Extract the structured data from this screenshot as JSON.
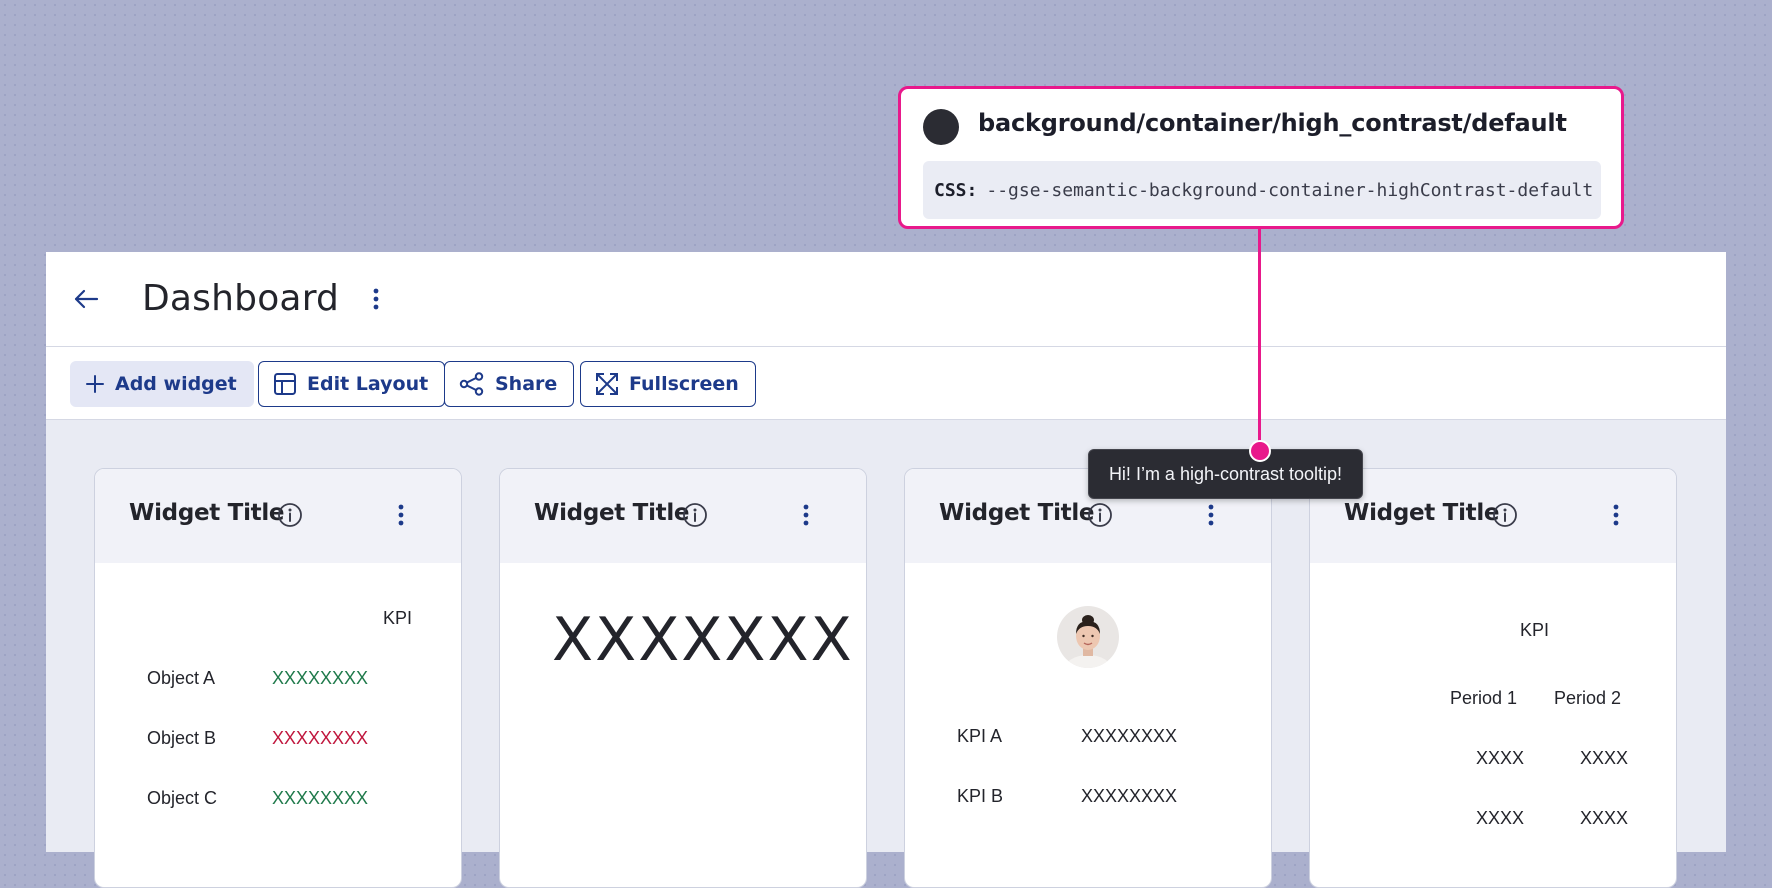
{
  "header": {
    "title": "Dashboard"
  },
  "toolbar": {
    "add_widget": "Add widget",
    "edit_layout": "Edit Layout",
    "share": "Share",
    "fullscreen": "Fullscreen"
  },
  "widgets": [
    {
      "title": "Widget Title",
      "kpi_header": "KPI",
      "rows": [
        {
          "label": "Object A",
          "value": "XXXXXXXX",
          "status": "positive"
        },
        {
          "label": "Object B",
          "value": "XXXXXXXX",
          "status": "negative"
        },
        {
          "label": "Object C",
          "value": "XXXXXXXX",
          "status": "positive"
        }
      ]
    },
    {
      "title": "Widget Title",
      "big_value": "XXXXXXX"
    },
    {
      "title": "Widget Title",
      "rows": [
        {
          "label": "KPI A",
          "value": "XXXXXXXX"
        },
        {
          "label": "KPI B",
          "value": "XXXXXXXX"
        }
      ]
    },
    {
      "title": "Widget Title",
      "kpi_header": "KPI",
      "columns": [
        "Period 1",
        "Period 2"
      ],
      "rows": [
        [
          "XXXX",
          "XXXX"
        ],
        [
          "XXXX",
          "XXXX"
        ]
      ]
    }
  ],
  "tooltip": {
    "text": "Hi! I’m a high-contrast tooltip!"
  },
  "annotation": {
    "token": "background/container/high_contrast/default",
    "css_label": "CSS:",
    "css_var": "--gse-semantic-background-container-highContrast-default",
    "swatch_color": "#2b2c33"
  },
  "colors": {
    "accent": "#1d3a8a",
    "positive": "#1f7a4b",
    "negative": "#c0163d",
    "annotation": "#e8198b"
  }
}
